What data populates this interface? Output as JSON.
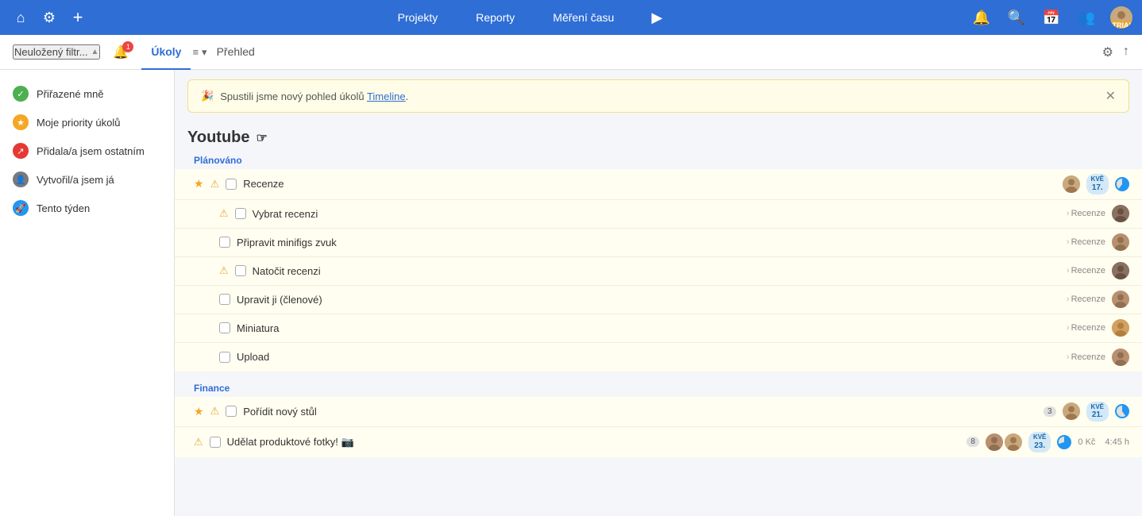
{
  "topnav": {
    "projects_label": "Projekty",
    "reports_label": "Reporty",
    "time_label": "Měření času",
    "icons": {
      "home": "⌂",
      "settings": "⚙",
      "add": "+",
      "play": "▶",
      "bell": "🔔",
      "search": "🔍",
      "calendar": "📅",
      "people": "👥"
    },
    "trial": "TRIAL"
  },
  "subheader": {
    "filter_label": "Neuložený filtr...",
    "notif_count": "1",
    "tasks_label": "Úkoly",
    "overview_label": "Přehled",
    "icons": {
      "options": "≡",
      "chevron_down": "▾",
      "settings": "⚙",
      "share": "↑"
    }
  },
  "sidebar": {
    "items": [
      {
        "id": "assigned",
        "label": "Přiřazené mně",
        "color": "#4caf50"
      },
      {
        "id": "priority",
        "label": "Moje priority úkolů",
        "color": "#f5a623"
      },
      {
        "id": "assigned-others",
        "label": "Přidala/a jsem ostatním",
        "color": "#e53935"
      },
      {
        "id": "created",
        "label": "Vytvořil/a jsem já",
        "color": "#7a7a7a"
      },
      {
        "id": "this-week",
        "label": "Tento týden",
        "color": "#2196f3"
      }
    ]
  },
  "notification": {
    "emoji": "🎉",
    "text": "Spustili jsme nový pohled úkolů ",
    "link": "Timeline",
    "text2": "."
  },
  "projects": [
    {
      "name": "Youtube",
      "sections": [
        {
          "label": "Plánováno",
          "tasks": [
            {
              "id": "recenze",
              "name": "Recenze",
              "starred": true,
              "warning": true,
              "date": {
                "month": "kvě",
                "day": "17."
              },
              "avatar": "person1",
              "progress_circle": true,
              "subtasks": [
                {
                  "name": "Vybrat recenzi",
                  "tag": "Recenze",
                  "warning": true,
                  "avatar": "person2"
                },
                {
                  "name": "Připravit minifigs zvuk",
                  "tag": "Recenze",
                  "avatar": "person3"
                },
                {
                  "name": "Natočit recenzi",
                  "tag": "Recenze",
                  "warning": true,
                  "avatar": "person2"
                },
                {
                  "name": "Upravit ji (členové)",
                  "tag": "Recenze",
                  "avatar": "person3"
                },
                {
                  "name": "Miniatura",
                  "tag": "Recenze",
                  "avatar": "person4"
                },
                {
                  "name": "Upload",
                  "tag": "Recenze",
                  "avatar": "person3"
                }
              ]
            }
          ]
        }
      ]
    },
    {
      "name": "Finance",
      "sections": [
        {
          "label": "Finance",
          "tasks": [
            {
              "id": "stul",
              "name": "Pořídit nový stůl",
              "starred": true,
              "warning": true,
              "count": "3",
              "date": {
                "month": "kvě",
                "day": "21."
              },
              "avatar": "person5",
              "progress_circle": true
            },
            {
              "id": "fotky",
              "name": "Udělat produktové fotky! 📷",
              "warning": true,
              "count": "8",
              "date": {
                "month": "kvě",
                "day": "23."
              },
              "avatar": "person6",
              "avatar2": "person7",
              "progress_circle": true,
              "meta_left": "0 Kč",
              "meta_right": "4:45 h"
            }
          ]
        }
      ]
    }
  ]
}
